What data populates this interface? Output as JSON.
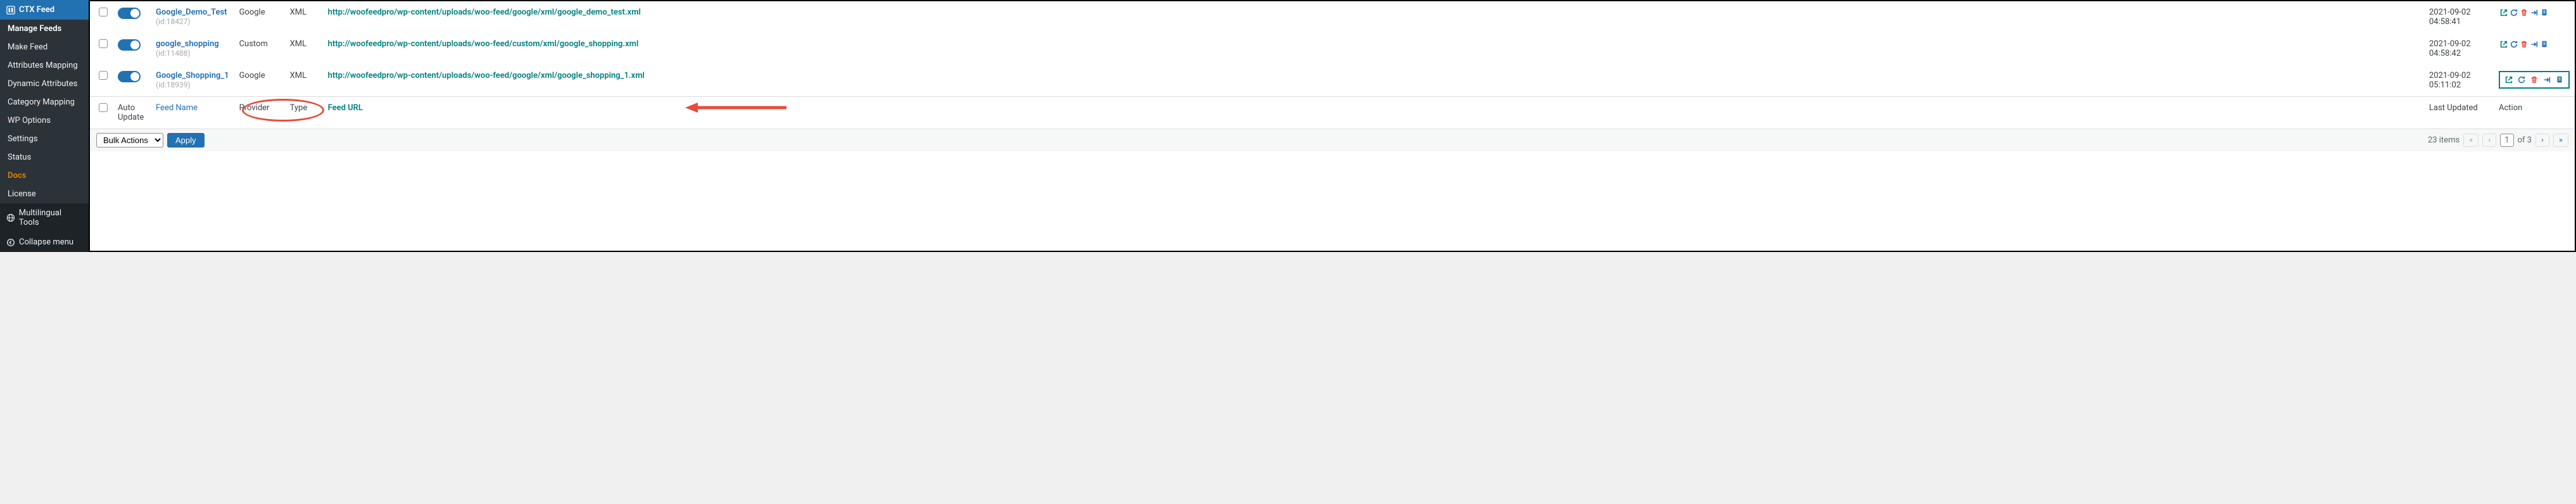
{
  "sidebar": {
    "title": "CTX Feed",
    "items": [
      {
        "label": "Manage Feeds",
        "active": true
      },
      {
        "label": "Make Feed"
      },
      {
        "label": "Attributes Mapping"
      },
      {
        "label": "Dynamic Attributes"
      },
      {
        "label": "Category Mapping"
      },
      {
        "label": "WP Options"
      },
      {
        "label": "Settings"
      },
      {
        "label": "Status"
      },
      {
        "label": "Docs",
        "docs": true
      },
      {
        "label": "License"
      }
    ],
    "multilingual": "Multilingual Tools",
    "collapse": "Collapse menu"
  },
  "columns": {
    "auto_update": "Auto Update",
    "feed_name": "Feed Name",
    "provider": "Provider",
    "type": "Type",
    "feed_url": "Feed URL",
    "last_updated": "Last Updated",
    "action": "Action"
  },
  "rows": [
    {
      "name": "Google_Demo_Test",
      "id": "(id:18427)",
      "provider": "Google",
      "type": "XML",
      "url": "http://woofeedpro/wp-content/uploads/woo-feed/google/xml/google_demo_test.xml",
      "updated_date": "2021-09-02",
      "updated_time": "04:58:41",
      "highlight": false
    },
    {
      "name": "google_shopping",
      "id": "(id:11488)",
      "provider": "Custom",
      "type": "XML",
      "url": "http://woofeedpro/wp-content/uploads/woo-feed/custom/xml/google_shopping.xml",
      "updated_date": "2021-09-02",
      "updated_time": "04:58:42",
      "highlight": false
    },
    {
      "name": "Google_Shopping_1",
      "id": "(id:18939)",
      "provider": "Google",
      "type": "XML",
      "url": "http://woofeedpro/wp-content/uploads/woo-feed/google/xml/google_shopping_1.xml",
      "updated_date": "2021-09-02",
      "updated_time": "05:11:02",
      "highlight": true
    }
  ],
  "bulk": {
    "label": "Bulk Actions",
    "apply": "Apply"
  },
  "pagination": {
    "total": "23 items",
    "current": "1",
    "of": "of 3"
  }
}
